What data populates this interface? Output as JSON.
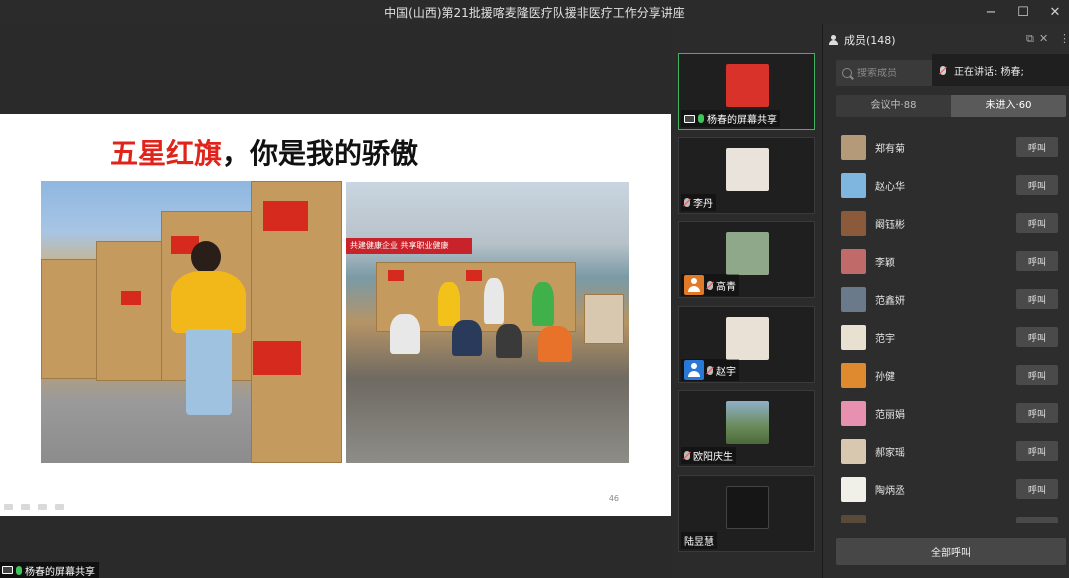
{
  "window": {
    "title": "中国(山西)第21批援喀麦隆医疗队援非医疗工作分享讲座",
    "minimize": "−",
    "maximize": "☐",
    "close": "✕"
  },
  "slide": {
    "title_red": "五星红旗",
    "title_rest": "，你是我的骄傲",
    "banner": "共建健康企业  共享职业健康",
    "page_number": "46"
  },
  "share_label": "杨春的屏幕共享",
  "video_tiles": [
    {
      "name": "杨春的屏幕共享",
      "avatar_color": "#d8322a"
    },
    {
      "name": "李丹",
      "avatar_color": "#e9e3dc"
    },
    {
      "name": "高青",
      "avatar_color": "#8fa88a",
      "badge_color": "#e07a28"
    },
    {
      "name": "赵宇",
      "avatar_color": "#e9e1d6",
      "badge_color": "#2a78d6"
    },
    {
      "name": "欧阳庆生",
      "avatar_color": "#7ea0b5"
    },
    {
      "name": "陆昱慧",
      "avatar_color": "#161616"
    }
  ],
  "panel": {
    "title": "成员(148)",
    "pop_out": "⧉",
    "close": "✕",
    "search_placeholder": "搜索成员",
    "speaking_text": "正在讲话: 杨春;",
    "tabs": [
      {
        "label": "会议中·88",
        "selected": false
      },
      {
        "label": "未进入·60",
        "selected": true
      }
    ],
    "call_label": "呼叫",
    "call_all_label": "全部呼叫",
    "members": [
      {
        "name": "郑有菊",
        "avatar_color": "#b59a7a"
      },
      {
        "name": "赵心华",
        "avatar_color": "#7fb6e0"
      },
      {
        "name": "阚钰彬",
        "avatar_color": "#8a5a3a"
      },
      {
        "name": "李颖",
        "avatar_color": "#c06a6a"
      },
      {
        "name": "范鑫妍",
        "avatar_color": "#6a7a8a"
      },
      {
        "name": "范宇",
        "avatar_color": "#e8e0d0"
      },
      {
        "name": "孙健",
        "avatar_color": "#e08a30"
      },
      {
        "name": "范丽娟",
        "avatar_color": "#e890b0"
      },
      {
        "name": "郝家瑶",
        "avatar_color": "#d8c8b0"
      },
      {
        "name": "陶炳丞",
        "avatar_color": "#f0f0e8"
      },
      {
        "name": "",
        "avatar_color": "#5a4a3a"
      }
    ]
  }
}
